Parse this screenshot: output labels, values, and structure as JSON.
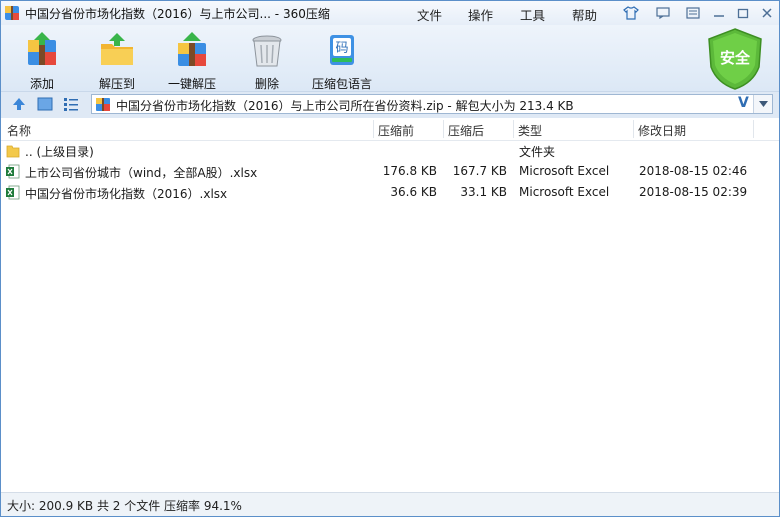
{
  "window": {
    "title": "中国分省份市场化指数（2016）与上市公司... - 360压缩",
    "menu": [
      "文件",
      "操作",
      "工具",
      "帮助"
    ]
  },
  "toolbar": {
    "buttons": [
      {
        "label": "添加",
        "icon": "add-archive-icon"
      },
      {
        "label": "解压到",
        "icon": "extract-to-icon"
      },
      {
        "label": "一键解压",
        "icon": "one-click-extract-icon"
      },
      {
        "label": "删除",
        "icon": "trash-bin-icon"
      },
      {
        "label": "压缩包语言",
        "icon": "archive-language-icon"
      }
    ],
    "security_badge": "安全",
    "encoding_char": "码"
  },
  "address": {
    "path": "中国分省份市场化指数（2016）与上市公司所在省份资料.zip - 解包大小为 213.4 KB",
    "v_label": "V"
  },
  "columns": {
    "name": "名称",
    "packed": "压缩前",
    "size": "压缩后",
    "type": "类型",
    "modified": "修改日期"
  },
  "files": [
    {
      "name": ".. (上级目录)",
      "packed": "",
      "size": "",
      "type": "文件夹",
      "modified": "",
      "icon": "folder-icon"
    },
    {
      "name": "上市公司省份城市（wind，全部A股）.xlsx",
      "packed": "176.8 KB",
      "size": "167.7 KB",
      "type": "Microsoft Excel",
      "modified": "2018-08-15 02:46",
      "icon": "excel-file-icon"
    },
    {
      "name": "中国分省份市场化指数（2016）.xlsx",
      "packed": "36.6 KB",
      "size": "33.1 KB",
      "type": "Microsoft Excel",
      "modified": "2018-08-15 02:39",
      "icon": "excel-file-icon"
    }
  ],
  "status": "大小: 200.9 KB 共 2 个文件 压缩率 94.1%",
  "colors": {
    "accent": "#2f6db3",
    "badge_green": "#4caf2a",
    "excel_green": "#1e7b3a",
    "folder_yellow": "#f3c94b"
  }
}
